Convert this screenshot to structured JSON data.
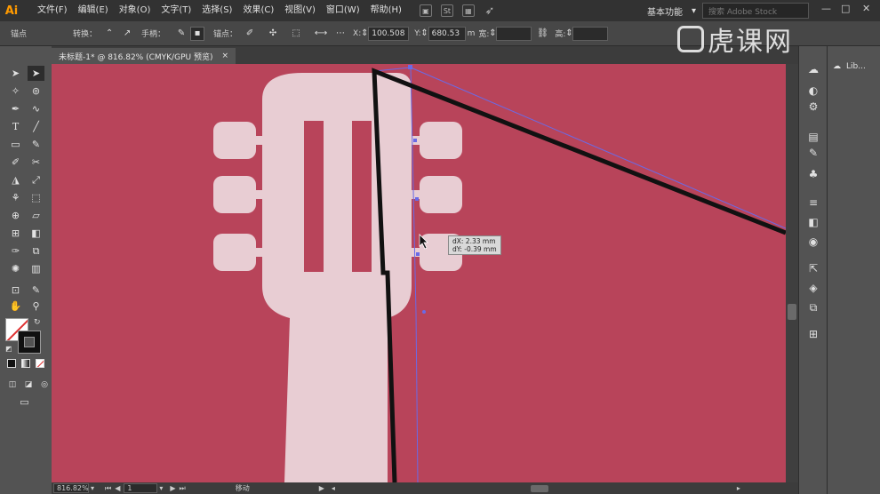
{
  "app": {
    "logo": "Ai"
  },
  "menu": [
    "文件(F)",
    "编辑(E)",
    "对象(O)",
    "文字(T)",
    "选择(S)",
    "效果(C)",
    "视图(V)",
    "窗口(W)",
    "帮助(H)"
  ],
  "workspace": {
    "label": "基本功能",
    "search_placeholder": "搜索 Adobe Stock"
  },
  "window_controls": {
    "minimize": "—",
    "maximize": "□",
    "close": "✕"
  },
  "controlbar": {
    "anchor_label": "锚点",
    "convert_label": "转换：",
    "handles_label": "手柄：",
    "anchors_label": "锚点：",
    "x_label": "X:",
    "x_value": "100.508",
    "y_label": "Y:",
    "y_value": "680.53",
    "y_unit": "m",
    "width_label": "宽:",
    "height_label": "高:"
  },
  "doc_tab": {
    "title": "未标题-1* @ 816.82% (CMYK/GPU 预览)",
    "close": "×"
  },
  "tooltip": {
    "dx": "dX: 2.33 mm",
    "dy": "dY: -0.39 mm"
  },
  "statusbar": {
    "zoom": "816.82%",
    "artboard": "1",
    "status": "移动"
  },
  "library": {
    "label": "Lib..."
  },
  "watermark": {
    "text": "虎课网"
  },
  "colors": {
    "canvas": "#b8445a",
    "guitar": "#e8cdd3",
    "path": "#111111",
    "guide": "#6a6ae6"
  }
}
